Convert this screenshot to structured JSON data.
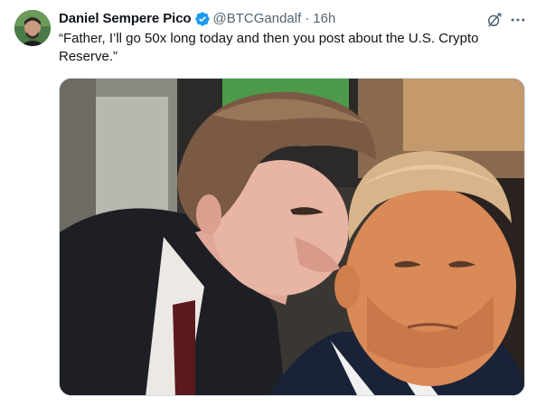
{
  "tweet": {
    "author": {
      "display_name": "Daniel Sempere Pico",
      "handle": "@BTCGandalf",
      "verified": true,
      "avatar_icon": "profile-photo"
    },
    "separator": "·",
    "timestamp": "16h",
    "text": "“Father, I’ll go 50x long today and then you post about the U.S. Crypto Reserve.”",
    "actions": {
      "grok_icon": "grok-icon",
      "more_icon": "more-icon"
    },
    "media": {
      "type": "image",
      "description_icon": "meme-photo"
    }
  },
  "colors": {
    "verified_blue": "#1d9bf0",
    "secondary_text": "#536471",
    "primary_text": "#0f1419",
    "border": "#cfd9de"
  }
}
